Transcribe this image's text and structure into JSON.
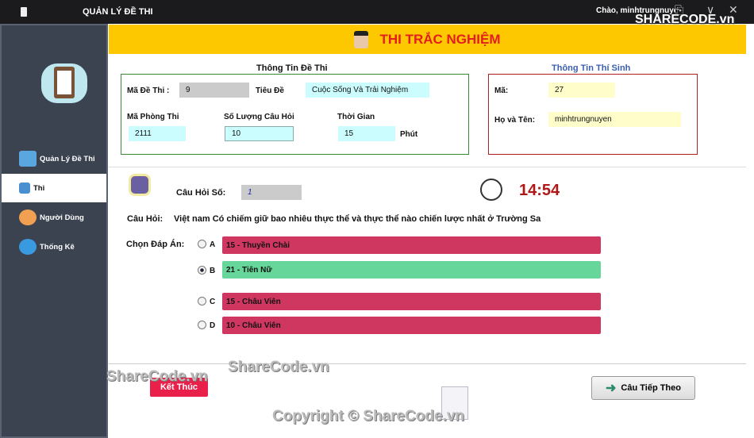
{
  "window": {
    "title": "QUẢN LÝ ĐỀ THI",
    "greeting": "Chào, minhtrungnuyen",
    "watermark_logo": "SHARECODE.vn"
  },
  "sidebar": {
    "items": [
      {
        "label": "Quản Lý Đề Thi",
        "icon": "exam-manage-icon"
      },
      {
        "label": "Thi",
        "icon": "exam-icon",
        "active": true
      },
      {
        "label": "Người Dùng",
        "icon": "user-icon"
      },
      {
        "label": "Thống Kê",
        "icon": "chart-icon"
      }
    ]
  },
  "header": {
    "title": "THI TRẮC NGHIỆM"
  },
  "exam_info": {
    "heading": "Thông Tin Đề Thi",
    "ma_de_label": "Mã Đề Thi :",
    "ma_de": "9",
    "tieu_de_label": "Tiêu Đề",
    "tieu_de": "Cuộc Sống Và Trải Nghiệm",
    "phong_label": "Mã Phòng Thi",
    "phong": "2111",
    "so_luong_label": "Số Lượng Câu Hỏi",
    "so_luong": "10",
    "thoi_gian_label": "Thời Gian",
    "thoi_gian": "15",
    "unit": "Phút"
  },
  "student": {
    "heading": "Thông Tin Thí Sinh",
    "ma_label": "Mã:",
    "ma": "27",
    "name_label": "Họ và Tên:",
    "name": "minhtrungnuyen"
  },
  "question": {
    "number_label": "Câu Hỏi Số:",
    "number": "1",
    "timer": "14:54",
    "label": "Câu Hỏi:",
    "text": "Việt nam Có chiếm giữ bao nhiêu thực thể và thực thể nào chiến lược nhất ở Trường Sa",
    "choose_label": "Chọn Đáp Án:",
    "answers": [
      {
        "key": "A",
        "text": "15 - Thuyền Chài",
        "color": "#cf3660",
        "selected": false
      },
      {
        "key": "B",
        "text": "21 - Tiên Nữ",
        "color": "#66d69a",
        "selected": true
      },
      {
        "key": "C",
        "text": "15 - Châu Viên",
        "color": "#cf3660",
        "selected": false
      },
      {
        "key": "D",
        "text": "10 - Châu Viên",
        "color": "#cf3660",
        "selected": false
      }
    ]
  },
  "buttons": {
    "end": "Kết Thúc",
    "next": "Câu Tiếp Theo"
  },
  "watermarks": {
    "a": "ShareCode.vn",
    "b": "ShareCode.vn",
    "copyright": "Copyright © ShareCode.vn"
  }
}
